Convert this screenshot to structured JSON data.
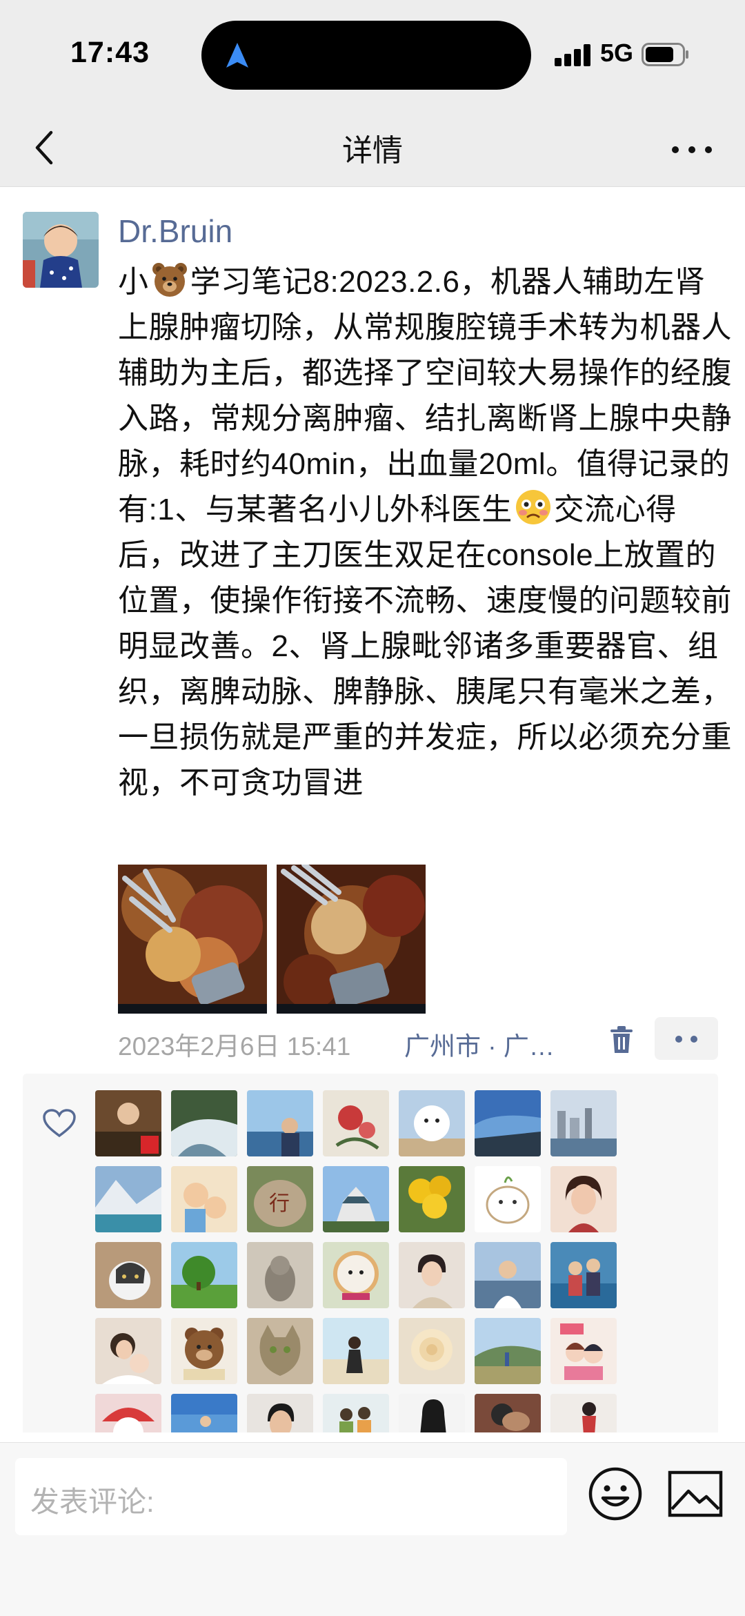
{
  "status_bar": {
    "time": "17:43",
    "network": "5G"
  },
  "nav": {
    "title": "详情"
  },
  "post": {
    "author": "Dr.Bruin",
    "text_before_emoji_1": "小",
    "text_after_emoji_1": "学习笔记8:2023.2.6，机器人辅助左肾上腺肿瘤切除，从常规腹腔镜手术转为机器人辅助为主后，都选择了空间较大易操作的经腹入路，常规分离肿瘤、结扎离断肾上腺中央静脉，耗时约40min，出血量20ml。值得记录的有:1、与某著名小儿外科医生",
    "text_after_emoji_2": "交流心得后，改进了主刀医生双足在console上放置的位置，使操作衔接不流畅、速度慢的问题较前明显改善。2、肾上腺毗邻诸多重要器官、组织，离脾动脉、脾静脉、胰尾只有毫米之差，一旦损伤就是严重的并发症，所以必须充分重视，不可贪功冒进",
    "emoji_1": "bear-emoji",
    "emoji_2": "flushed-face-emoji",
    "date": "2023年2月6日 15:41",
    "location": "广州市 · 广…",
    "photo_count": 2
  },
  "likes": {
    "avatar_count": 35
  },
  "comment": {
    "placeholder": "发表评论:"
  },
  "colors": {
    "link_blue": "#576b95",
    "bar_gray": "#ededed",
    "panel_gray": "#f7f7f7",
    "meta_gray": "#a6a6a6"
  }
}
